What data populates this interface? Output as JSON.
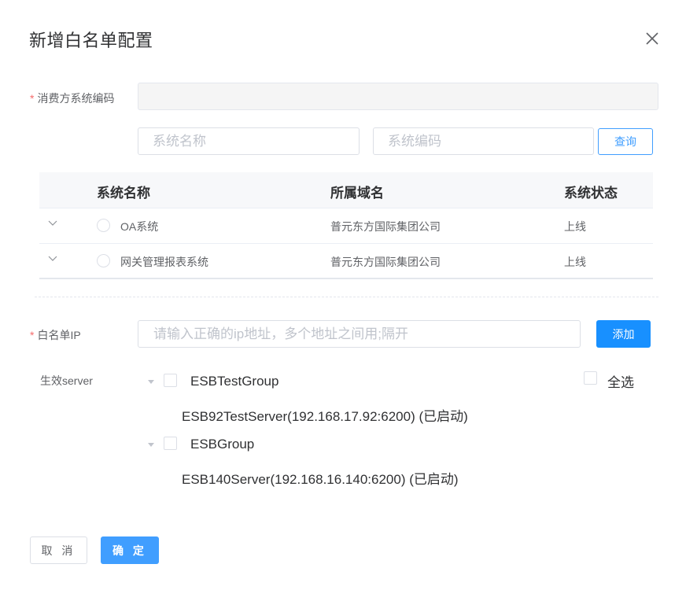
{
  "dialog": {
    "title": "新增白名单配置"
  },
  "consumer": {
    "label": "消费方系统编码",
    "value": ""
  },
  "search": {
    "name_placeholder": "系统名称",
    "code_placeholder": "系统编码",
    "button_label": "查询"
  },
  "table": {
    "headers": {
      "name": "系统名称",
      "domain": "所属域名",
      "status": "系统状态"
    },
    "rows": [
      {
        "name": "OA系统",
        "domain": "普元东方国际集团公司",
        "status": "上线"
      },
      {
        "name": "网关管理报表系统",
        "domain": "普元东方国际集团公司",
        "status": "上线"
      }
    ]
  },
  "whitelist_ip": {
    "label": "白名单IP",
    "placeholder": "请输入正确的ip地址，多个地址之间用;隔开",
    "add_label": "添加"
  },
  "server": {
    "label": "生效server",
    "select_all_label": "全选",
    "groups": [
      {
        "name": "ESBTestGroup",
        "server": "ESB92TestServer(192.168.17.92:6200) (已启动)"
      },
      {
        "name": "ESBGroup",
        "server": "ESB140Server(192.168.16.140:6200) (已启动)"
      }
    ]
  },
  "footer": {
    "cancel_label": "取 消",
    "ok_label": "确 定"
  },
  "colors": {
    "primary": "#409eff",
    "required": "#f56c6c"
  }
}
